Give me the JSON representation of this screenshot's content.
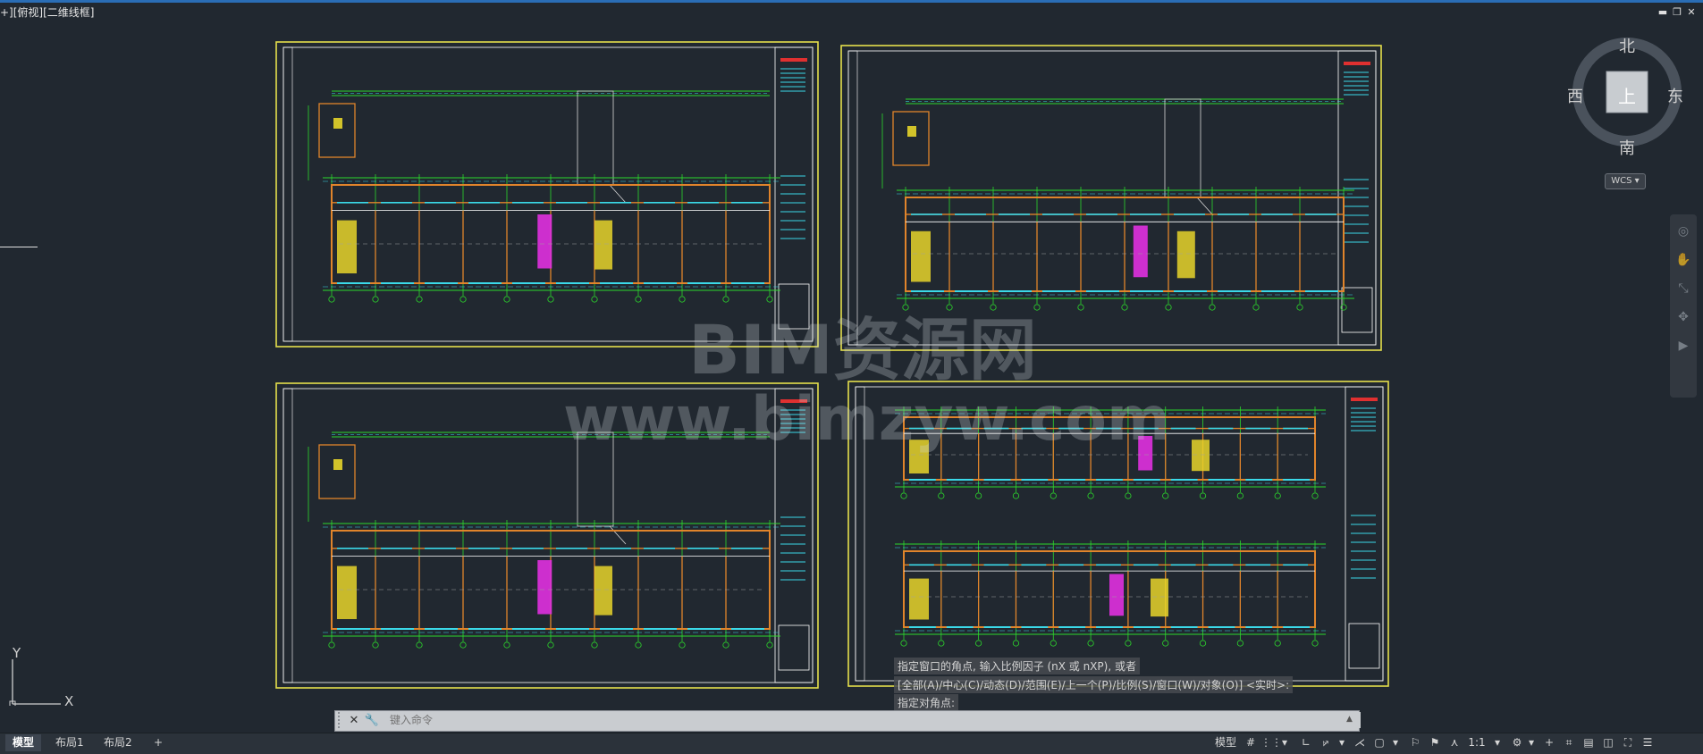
{
  "viewport": {
    "label": "+][俯视][二维线框]"
  },
  "window_controls": [
    "minimize-icon",
    "restore-icon",
    "close-icon"
  ],
  "watermark": {
    "line1": "BIM资源网",
    "line2": "www.bimzyw.com"
  },
  "viewcube": {
    "north": "北",
    "south": "南",
    "east": "东",
    "west": "西",
    "face": "上",
    "wcs": "WCS"
  },
  "ucs": {
    "x": "X",
    "y": "Y"
  },
  "command": {
    "history": [
      "指定窗口的角点, 输入比例因子 (nX 或 nXP), 或者",
      "[全部(A)/中心(C)/动态(D)/范围(E)/上一个(P)/比例(S)/窗口(W)/对象(O)] <实时>:",
      "指定对角点:"
    ],
    "placeholder": "键入命令"
  },
  "layout_tabs": [
    {
      "label": "模型",
      "active": true
    },
    {
      "label": "布局1",
      "active": false
    },
    {
      "label": "布局2",
      "active": false
    }
  ],
  "add_tab": "+",
  "status_bar": {
    "model": "模型",
    "scale": "1:1"
  },
  "colors": {
    "background": "#212830",
    "frame": "#e5e04b",
    "grid": "#2cd92c",
    "walls": "#e0842b",
    "dims": "#3bd9e8",
    "stairs": "#e6d42a",
    "magenta": "#e030e0",
    "red": "#e03030"
  }
}
